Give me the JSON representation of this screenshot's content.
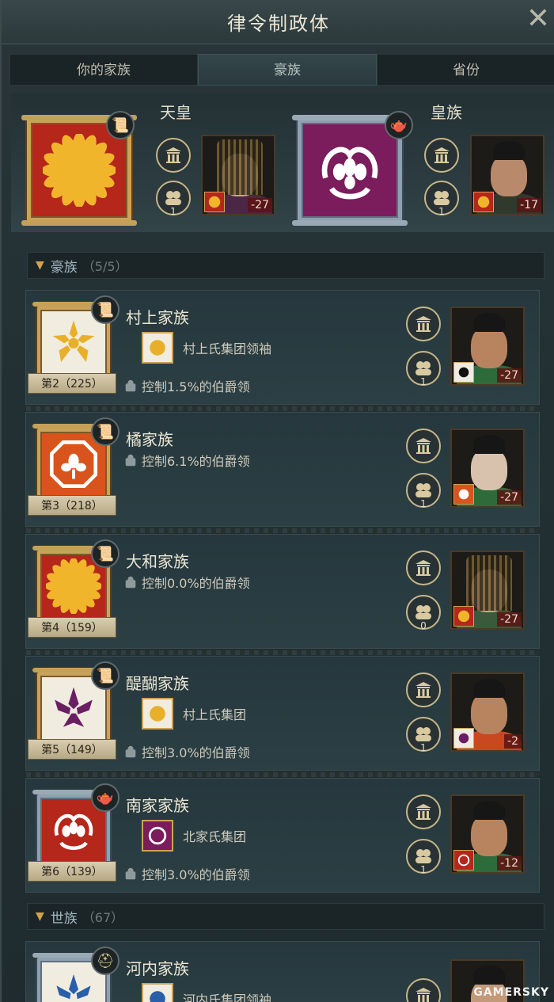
{
  "window": {
    "title": "律令制政体",
    "close_icon": "close-icon"
  },
  "tabs": [
    {
      "label": "你的家族",
      "active": false
    },
    {
      "label": "豪族",
      "active": true
    },
    {
      "label": "省份",
      "active": false
    }
  ],
  "rulers": [
    {
      "title": "天皇",
      "house_count": "1",
      "opinion": "-27",
      "banner_color": "#b5261b",
      "crest_color": "#f1b52c"
    },
    {
      "title": "皇族",
      "house_count": "1",
      "opinion": "-17",
      "banner_color": "#7b1c5c",
      "crest_color": "#ffffff"
    }
  ],
  "sections": [
    {
      "label": "豪族",
      "count": "（5/5）"
    },
    {
      "label": "世族",
      "count": "（67）"
    }
  ],
  "clans": [
    {
      "name": "村上家族",
      "rank": "第2（225）",
      "group": "村上氏集团领袖",
      "control": "控制1.5%的伯爵领",
      "house_count": "1",
      "opinion": "-27",
      "banner_color": "#f0ece0",
      "crest_color": "#e8b02a"
    },
    {
      "name": "橘家族",
      "rank": "第3（218）",
      "group": "",
      "control": "控制6.1%的伯爵领",
      "house_count": "1",
      "opinion": "-27",
      "banner_color": "#d9541c",
      "crest_color": "#ffffff"
    },
    {
      "name": "大和家族",
      "rank": "第4（159）",
      "group": "",
      "control": "控制0.0%的伯爵领",
      "house_count": "0",
      "opinion": "-27",
      "banner_color": "#b5261b",
      "crest_color": "#f1b52c"
    },
    {
      "name": "醍醐家族",
      "rank": "第5（149）",
      "group": "村上氏集团",
      "control": "控制3.0%的伯爵领",
      "house_count": "1",
      "opinion": "-2",
      "banner_color": "#f0ece0",
      "crest_color": "#6a1f63"
    },
    {
      "name": "南家家族",
      "rank": "第6（139）",
      "group": "北家氏集团",
      "control": "控制3.0%的伯爵领",
      "house_count": "1",
      "opinion": "-12",
      "banner_color": "#b5261b",
      "crest_color": "#ffffff"
    },
    {
      "name": "河内家族",
      "rank": "",
      "group": "河内氏集团领袖",
      "control": "",
      "house_count": "",
      "opinion": "",
      "banner_color": "#f0ece0",
      "crest_color": "#2a5ea8"
    }
  ],
  "watermark": "GAMERSKY"
}
